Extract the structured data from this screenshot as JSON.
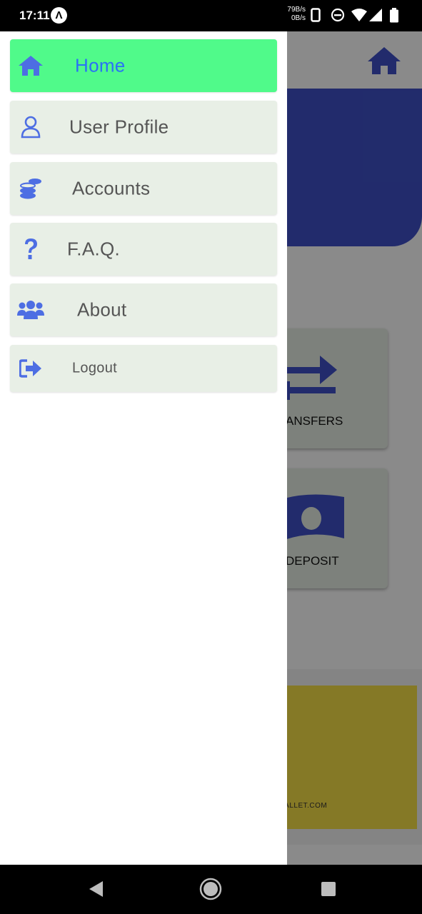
{
  "status_bar": {
    "time": "17:11",
    "app_badge": "Λ",
    "net_up": "79B/s",
    "net_down": "0B/s"
  },
  "background": {
    "tiles": [
      {
        "label": "ANSFERS",
        "icon": "transfer-arrows-icon"
      },
      {
        "label": "DEPOSIT",
        "icon": "money-bill-icon"
      }
    ],
    "promo_text": "TWALLET.COM",
    "accent": "#3f51c8",
    "promo_color": "#f6e047"
  },
  "drawer": {
    "items": [
      {
        "label": "Home",
        "icon": "home-icon",
        "active": true
      },
      {
        "label": "User Profile",
        "icon": "user-icon",
        "active": false
      },
      {
        "label": "Accounts",
        "icon": "coins-icon",
        "active": false
      },
      {
        "label": "F.A.Q.",
        "icon": "question-icon",
        "active": false
      },
      {
        "label": "About",
        "icon": "users-icon",
        "active": false
      },
      {
        "label": "Logout",
        "icon": "logout-icon",
        "active": false
      }
    ],
    "active_color": "#50fa8a",
    "item_color": "#e8efe6",
    "icon_color": "#4d6ee3"
  },
  "nav_bar": {
    "buttons": [
      "back-icon",
      "home-circle-icon",
      "recents-icon"
    ]
  }
}
